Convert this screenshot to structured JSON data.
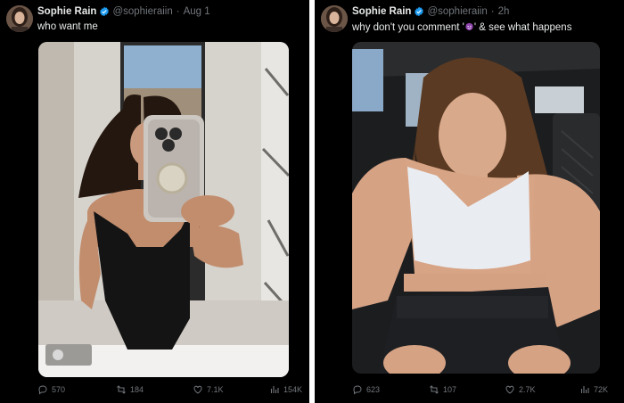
{
  "tweets": [
    {
      "author": {
        "name": "Sophie Rain",
        "handle": "@sophieraiin"
      },
      "time": "Aug 1",
      "text": "who want me",
      "stats": {
        "replies": "570",
        "reposts": "184",
        "likes": "7.1K",
        "views": "154K"
      }
    },
    {
      "author": {
        "name": "Sophie Rain",
        "handle": "@sophieraiin"
      },
      "time": "2h",
      "text_before": "why don't you comment '",
      "text_emoji": "smiling-devil-emoji",
      "text_after": "' & see what happens",
      "stats": {
        "replies": "623",
        "reposts": "107",
        "likes": "2.7K",
        "views": "72K"
      }
    }
  ],
  "ui": {
    "dot": "·"
  },
  "colors": {
    "background": "#000000",
    "text": "#e7e9ea",
    "secondary": "#71767b",
    "verified": "#1d9bf0",
    "emoji": "#8e44ad"
  },
  "icons": [
    "verified-badge-icon",
    "reply-icon",
    "repost-icon",
    "like-icon",
    "views-icon"
  ]
}
